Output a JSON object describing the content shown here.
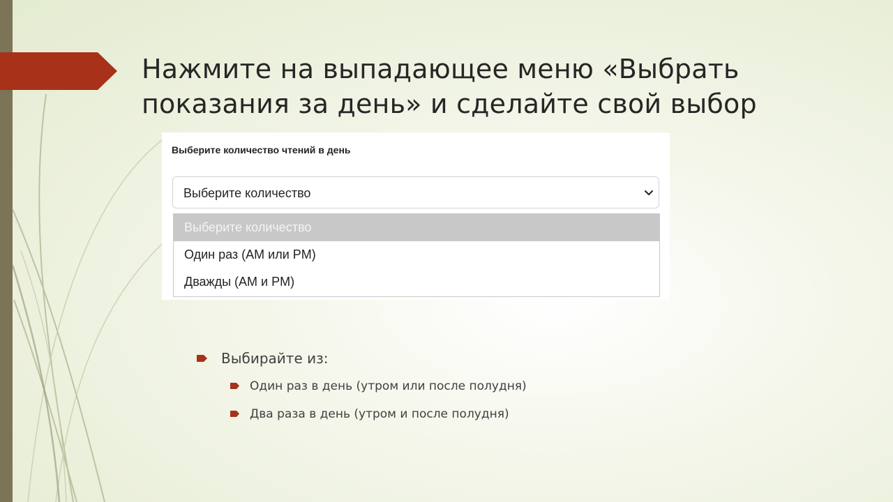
{
  "slide": {
    "title": "Нажмите на выпадающее меню «Выбрать показания за день» и сделайте свой выбор"
  },
  "screenshot": {
    "field_label": "Выберите количество чтений в день",
    "select": {
      "value": "Выберите количество"
    },
    "options": [
      {
        "label": "Выберите количество",
        "selected": true
      },
      {
        "label": "Один раз (AM или PM)",
        "selected": false
      },
      {
        "label": "Дважды (AM и PM)",
        "selected": false
      }
    ]
  },
  "bullets": {
    "heading": "Выбирайте из:",
    "items": [
      "Один раз в день (утром или после полудня)",
      "Два раза в день (утром и после полудня)"
    ]
  },
  "colors": {
    "accent": "#a8311a",
    "left_bar": "#7b7457",
    "title_text": "#262626",
    "option_highlight": "#c8c8c8"
  },
  "icons": {
    "title_marker": "arrow-pentagon-icon",
    "bullet": "arrow-bullet-icon",
    "select_chevron": "chevron-down-icon"
  }
}
